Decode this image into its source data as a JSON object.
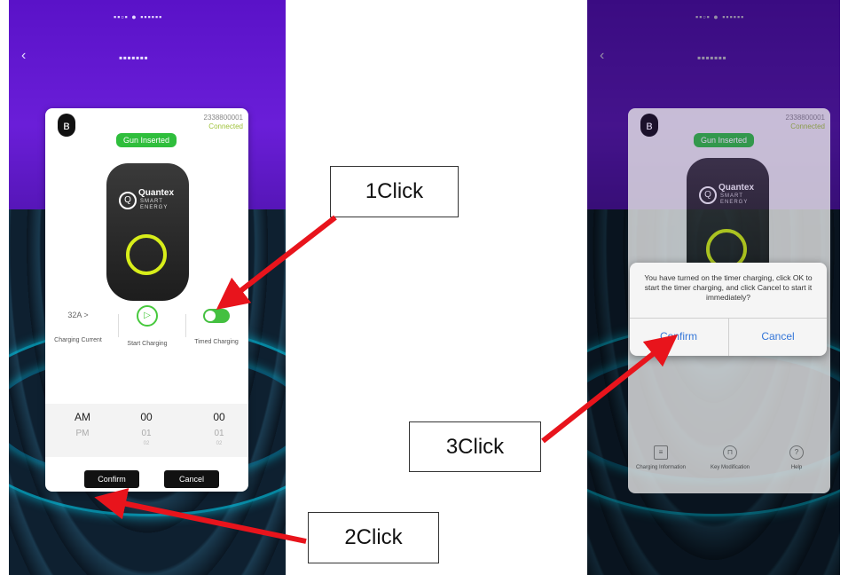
{
  "left_phone": {
    "serial": "2338800001",
    "connection_status": "Connected",
    "gun_status": "Gun Inserted",
    "brand_name": "Quantex",
    "brand_sub1": "SMART",
    "brand_sub2": "ENERGY",
    "current_value": "32A >",
    "current_label": "Charging Current",
    "start_label": "Start Charging",
    "timed_label": "Timed Charging",
    "picker": {
      "ampm_selected": "AM",
      "ampm_next": "PM",
      "hour_selected": "00",
      "hour_next": "01",
      "hour_next2": "02",
      "minute_selected": "00",
      "minute_next": "01",
      "minute_next2": "02"
    },
    "confirm_label": "Confirm",
    "cancel_label": "Cancel"
  },
  "right_phone": {
    "serial": "2338800001",
    "connection_status": "Connected",
    "gun_status": "Gun Inserted",
    "brand_name": "Quantex",
    "brand_sub1": "SMART",
    "brand_sub2": "ENERGY",
    "dialog_message": "You have turned on the timer charging, click OK to start the timer charging, and click Cancel to start it immediately?",
    "dialog_confirm": "Confirm",
    "dialog_cancel": "Cancel",
    "bottom_items": [
      "Charging Information",
      "Key Modification",
      "Help"
    ]
  },
  "callouts": {
    "step1": "1Click",
    "step2": "2Click",
    "step3": "3Click"
  },
  "icons": {
    "bluetooth": "bluetooth-icon",
    "play": "play-icon",
    "toggle": "toggle-switch",
    "document": "document-icon",
    "lock": "lock-icon",
    "help": "help-icon",
    "back": "back-arrow-icon"
  },
  "colors": {
    "header_purple": "#6a1ed8",
    "badge_green": "#2fbe3c",
    "ring_yellow": "#d8ee1a",
    "arrow_red": "#e8141c",
    "dialog_blue": "#3476d8"
  }
}
